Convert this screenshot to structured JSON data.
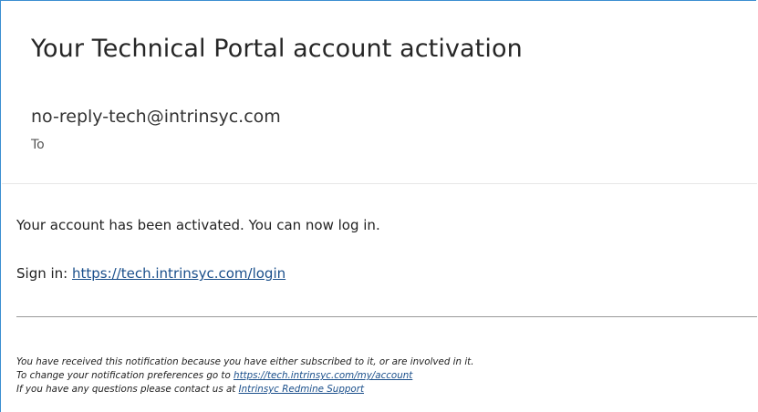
{
  "email": {
    "subject": "Your Technical Portal account activation",
    "sender": "no-reply-tech@intrinsyc.com",
    "to_label": "To"
  },
  "body": {
    "line1": "Your account has been activated. You can now log in.",
    "signin_prefix": "Sign in: ",
    "signin_link": "https://tech.intrinsyc.com/login"
  },
  "footer": {
    "line1": "You have received this notification because you have either subscribed to it, or are involved in it.",
    "line2_prefix": "To change your notification preferences go to ",
    "line2_link": "https://tech.intrinsyc.com/my/account",
    "line3_prefix": "If you have any questions please contact us at ",
    "line3_link": "Intrinsyc Redmine Support"
  },
  "colors": {
    "frame_border": "#3b8fd1",
    "link": "#1a4f8b"
  }
}
